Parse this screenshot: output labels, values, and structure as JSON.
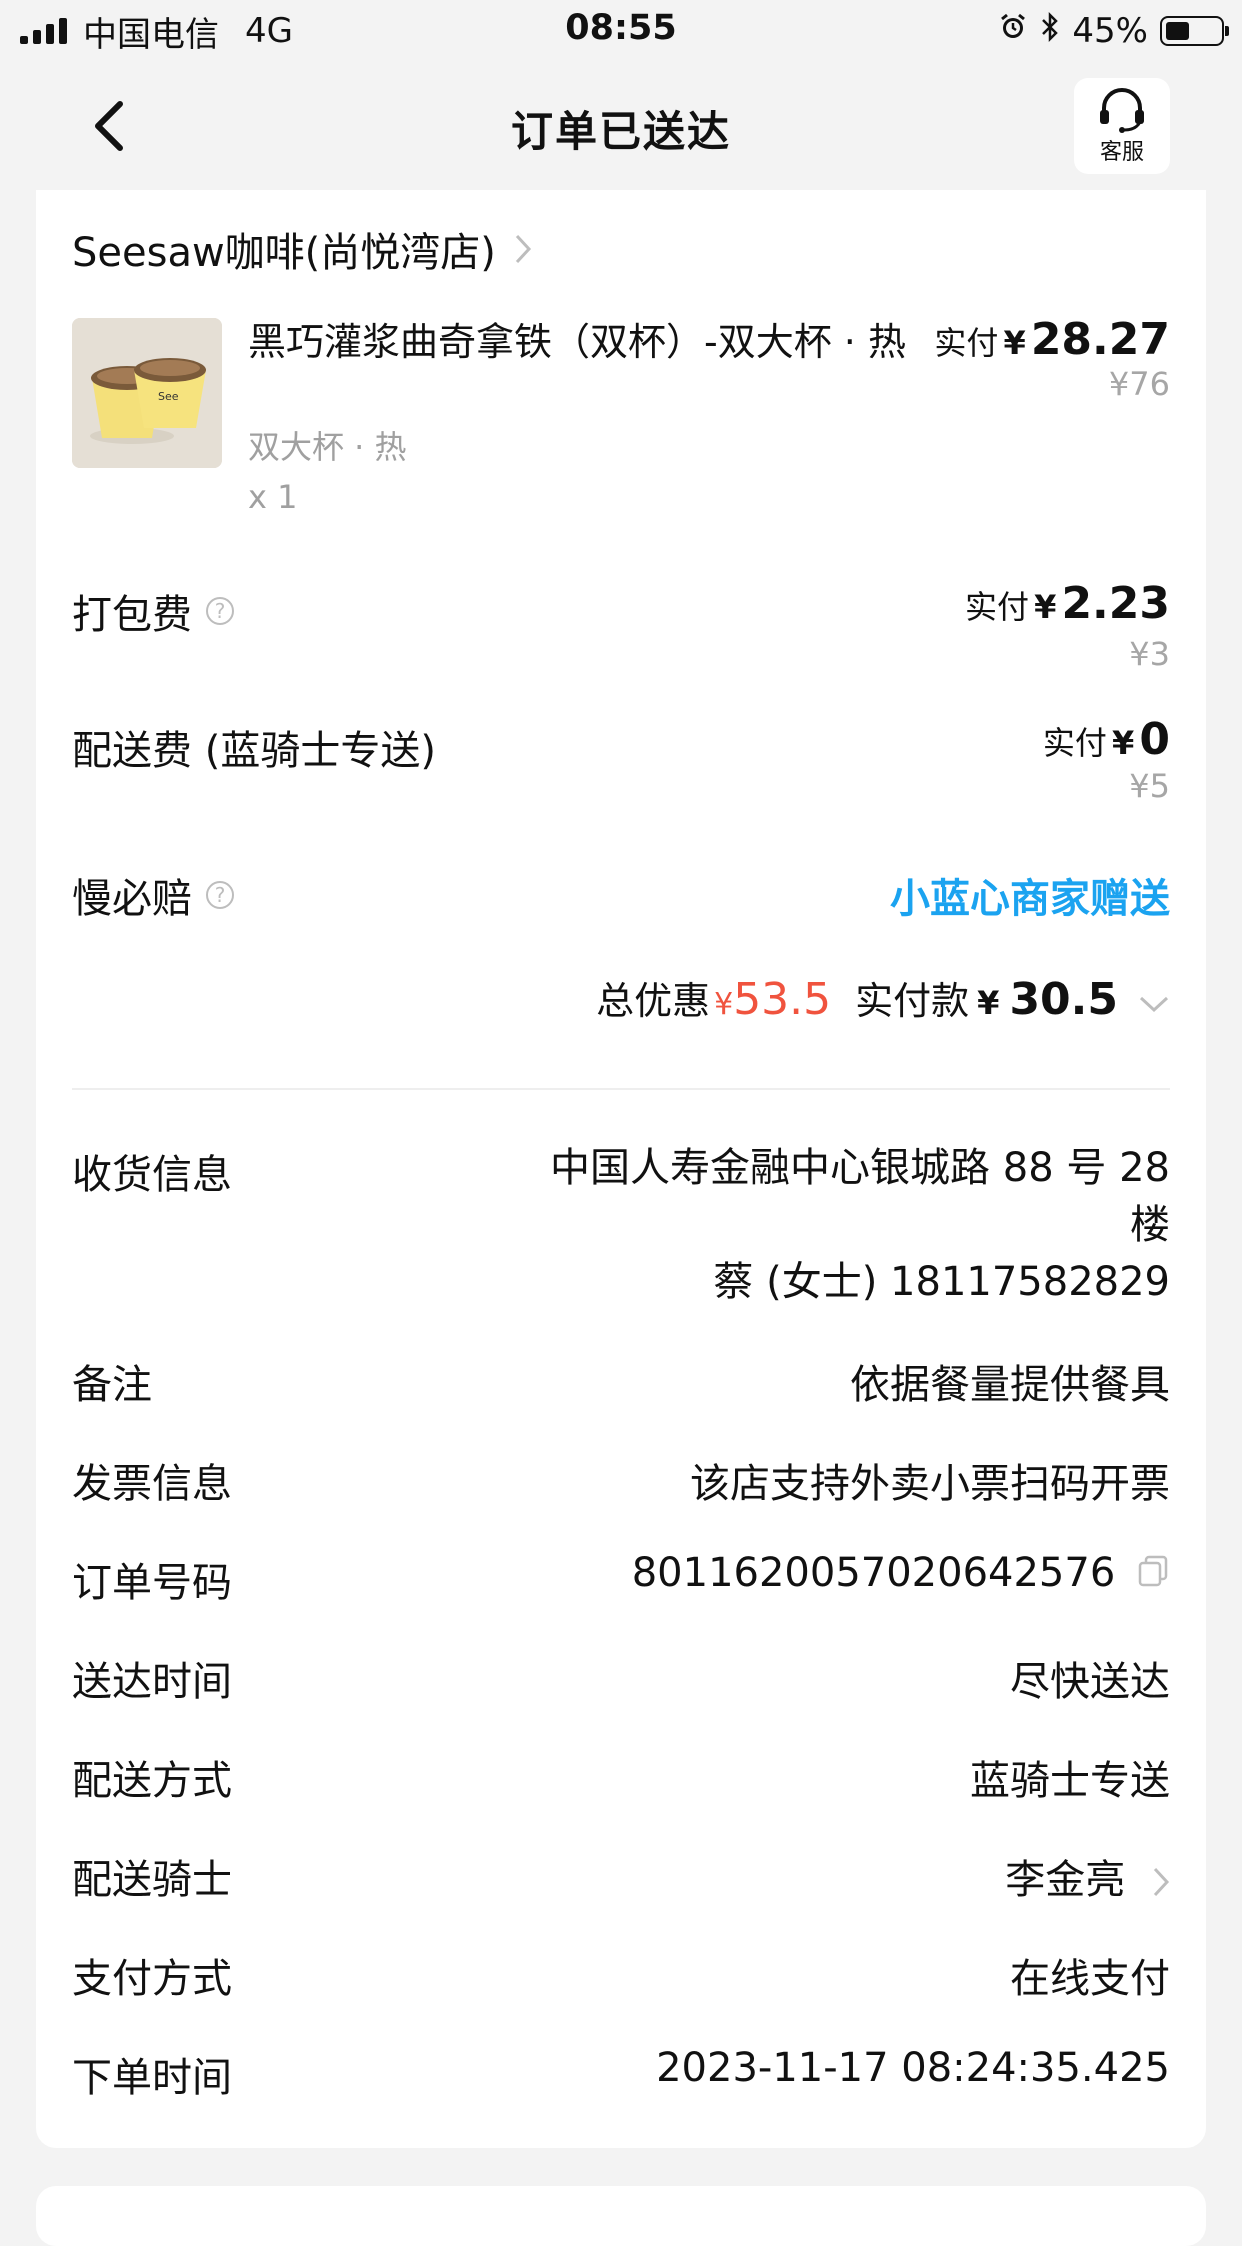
{
  "status_bar": {
    "carrier": "中国电信",
    "network": "4G",
    "time": "08:55",
    "battery": "45%",
    "battery_level": 0.45
  },
  "nav": {
    "title": "订单已送达",
    "service_label": "客服"
  },
  "shop": {
    "name": "Seesaw咖啡(尚悦湾店)"
  },
  "item": {
    "name": "黑巧灌浆曲奇拿铁（双杯）-双大杯 · 热",
    "spec": "双大杯 · 热",
    "qty": "x 1",
    "paid_label": "实付",
    "yen": "¥",
    "paid_value": "28.27",
    "original": "¥76"
  },
  "fees": {
    "packing": {
      "label": "打包费",
      "paid_label": "实付",
      "yen": "¥",
      "paid_value": "2.23",
      "original": "¥3"
    },
    "delivery": {
      "label": "配送费 (蓝骑士专送)",
      "paid_label": "实付",
      "yen": "¥",
      "paid_value": "0",
      "original": "¥5"
    },
    "slow_compensation": {
      "label": "慢必赔",
      "value": "小蓝心商家赠送"
    }
  },
  "summary": {
    "discount_label": "总优惠",
    "discount_yen": "¥",
    "discount_value": "53.5",
    "paid_label": "实付款",
    "paid_yen": "¥",
    "paid_value": "30.5"
  },
  "info": {
    "receiver_label": "收货信息",
    "receiver_address": "中国人寿金融中心银城路 88 号 28 楼",
    "receiver_contact": "蔡 (女士) 18117582829",
    "remark_label": "备注",
    "remark_value": "依据餐量提供餐具",
    "invoice_label": "发票信息",
    "invoice_value": "该店支持外卖小票扫码开票",
    "order_no_label": "订单号码",
    "order_no_value": "8011620057020642576",
    "delivery_time_label": "送达时间",
    "delivery_time_value": "尽快送达",
    "delivery_method_label": "配送方式",
    "delivery_method_value": "蓝骑士专送",
    "rider_label": "配送骑士",
    "rider_value": "李金亮",
    "payment_label": "支付方式",
    "payment_value": "在线支付",
    "order_time_label": "下单时间",
    "order_time_value": "2023-11-17 08:24:35.425"
  },
  "colors": {
    "accent_blue": "#1ba3f0",
    "discount_red": "#f0533e",
    "background": "#f3f3f3"
  }
}
